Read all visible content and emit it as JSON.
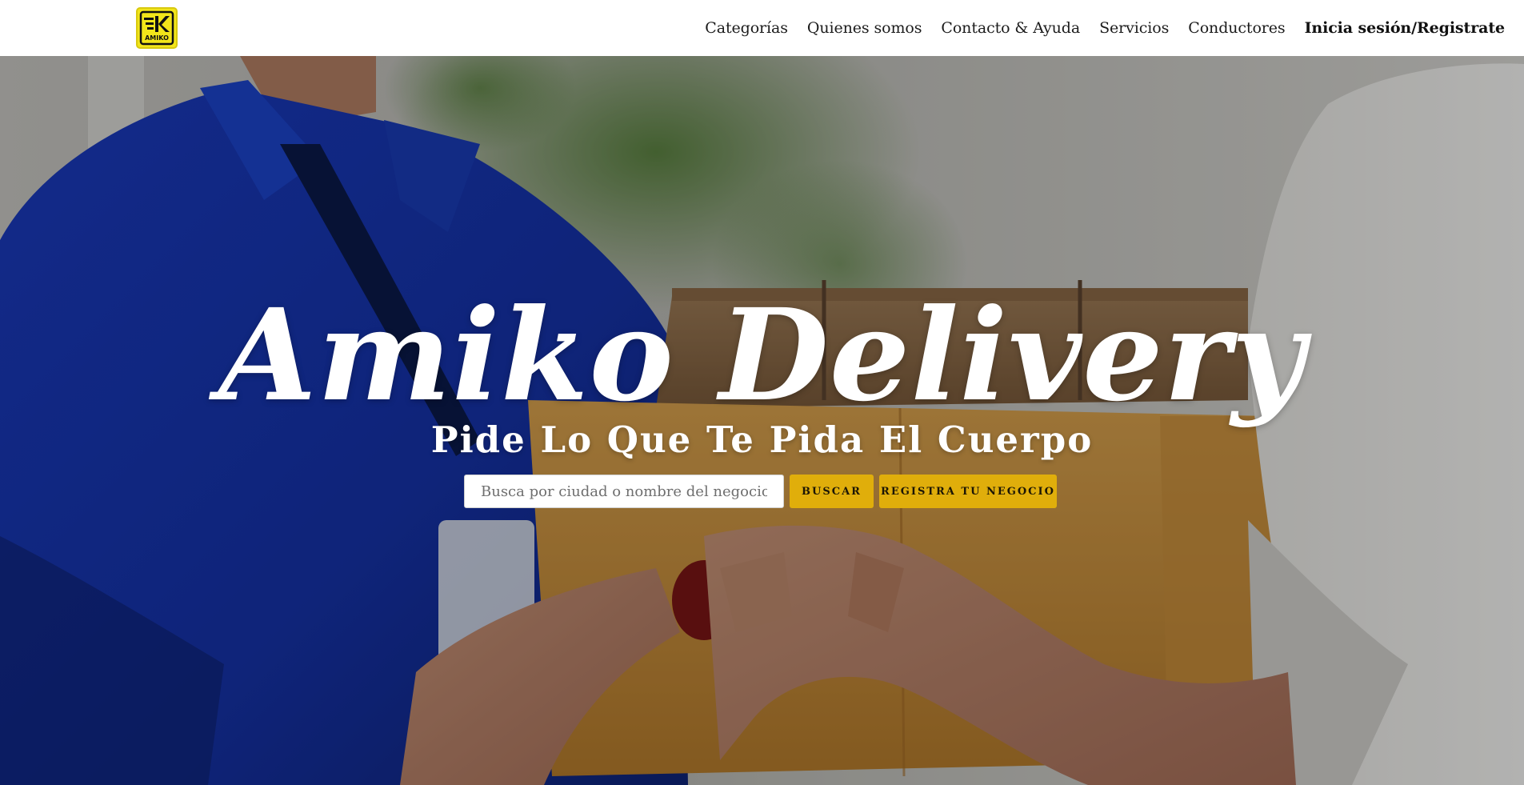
{
  "header": {
    "logo_text": "AMIKO",
    "logo_alt": "Amiko logo",
    "nav": [
      {
        "label": "Categorías"
      },
      {
        "label": "Quienes somos"
      },
      {
        "label": "Contacto & Ayuda"
      },
      {
        "label": "Servicios"
      },
      {
        "label": "Conductores"
      },
      {
        "label": "Inicia sesión/Registrate"
      }
    ]
  },
  "hero": {
    "title": "Amiko Delivery",
    "subtitle": "Pide Lo Que Te Pida El Cuerpo",
    "search": {
      "placeholder": "Busca por ciudad o nombre del negocio",
      "value": ""
    },
    "search_button": "BUSCAR",
    "register_button": "REGISTRA TU NEGOCIO"
  },
  "colors": {
    "accent": "#e0ae0b",
    "logo_bg": "#f2e51a",
    "uniform": "#1e3fc4"
  }
}
